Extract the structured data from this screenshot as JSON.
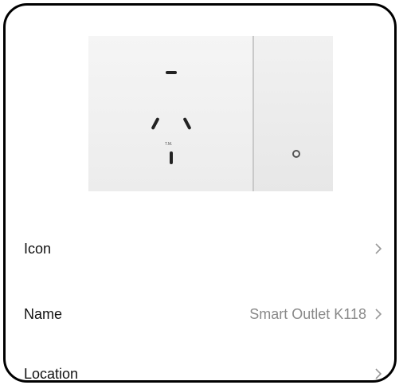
{
  "device": {
    "image_alt": "smart outlet device image",
    "socket_mark": "T.M."
  },
  "settings": {
    "rows": [
      {
        "label": "Icon",
        "value": "",
        "icon": "chevron-right-icon"
      },
      {
        "label": "Name",
        "value": "Smart Outlet K118",
        "icon": "chevron-right-icon"
      },
      {
        "label": "Location",
        "value": "",
        "icon": "chevron-right-icon"
      }
    ]
  },
  "colors": {
    "frame_border": "#000000",
    "label_text": "#111111",
    "value_text": "#8a8a8a",
    "chevron": "#9a9a9a"
  }
}
